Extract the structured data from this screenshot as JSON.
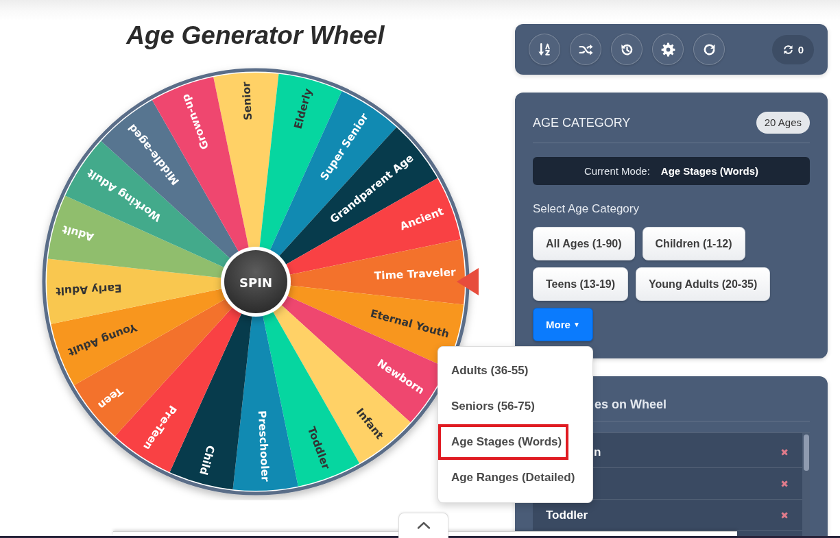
{
  "title": "Age Generator Wheel",
  "wheel": {
    "spin_label": "SPIN",
    "segments": [
      {
        "label": "Senior",
        "color": "#ffd166",
        "dark_label": true
      },
      {
        "label": "Elderly",
        "color": "#06d6a0",
        "dark_label": true
      },
      {
        "label": "Super Senior",
        "color": "#118ab2",
        "dark_label": false
      },
      {
        "label": "Grandparent Age",
        "color": "#073b4c",
        "dark_label": false
      },
      {
        "label": "Ancient",
        "color": "#f94144",
        "dark_label": false
      },
      {
        "label": "Time Traveler",
        "color": "#f3722c",
        "dark_label": false
      },
      {
        "label": "Eternal Youth",
        "color": "#f8961e",
        "dark_label": true
      },
      {
        "label": "Newborn",
        "color": "#ef476f",
        "dark_label": false
      },
      {
        "label": "Infant",
        "color": "#ffd166",
        "dark_label": true
      },
      {
        "label": "Toddler",
        "color": "#06d6a0",
        "dark_label": true
      },
      {
        "label": "Preschooler",
        "color": "#118ab2",
        "dark_label": false
      },
      {
        "label": "Child",
        "color": "#073b4c",
        "dark_label": false
      },
      {
        "label": "Pre-Teen",
        "color": "#f94144",
        "dark_label": false
      },
      {
        "label": "Teen",
        "color": "#f3722c",
        "dark_label": false
      },
      {
        "label": "Young Adult",
        "color": "#f8961e",
        "dark_label": true
      },
      {
        "label": "Early Adult",
        "color": "#f9c74f",
        "dark_label": true
      },
      {
        "label": "Adult",
        "color": "#90be6d",
        "dark_label": false
      },
      {
        "label": "Working Adult",
        "color": "#43aa8b",
        "dark_label": false
      },
      {
        "label": "Middle-aged",
        "color": "#577590",
        "dark_label": false
      },
      {
        "label": "Grown-up",
        "color": "#ef476f",
        "dark_label": false
      }
    ]
  },
  "toolbar": {
    "buttons": [
      {
        "kind": "sort"
      },
      {
        "kind": "shuffle"
      },
      {
        "kind": "history"
      },
      {
        "kind": "settings"
      },
      {
        "kind": "redo"
      }
    ],
    "spin_count": "0"
  },
  "category_panel": {
    "title": "AGE CATEGORY",
    "count_badge": "20 Ages",
    "mode_label": "Current Mode:",
    "mode_value": "Age Stages (Words)",
    "select_label": "Select Age Category",
    "options": [
      {
        "label": "All Ages (1-90)",
        "selected": false
      },
      {
        "label": "Children (1-12)",
        "selected": false
      },
      {
        "label": "Teens (13-19)",
        "selected": false
      },
      {
        "label": "Young Adults (20-35)",
        "selected": false
      }
    ],
    "more_button": {
      "label": "More",
      "caret": "▼",
      "expanded": true
    },
    "more_menu": [
      {
        "label": "Adults (36-55)",
        "highlighted": false
      },
      {
        "label": "Seniors (56-75)",
        "highlighted": false
      },
      {
        "label": "Age Stages (Words)",
        "highlighted": true
      },
      {
        "label": "Age Ranges (Detailed)",
        "highlighted": false
      }
    ]
  },
  "wheel_list": {
    "title": "es on Wheel",
    "title_covered": true,
    "items": [
      {
        "label": "n",
        "delete": "✖",
        "covered": true
      },
      {
        "delete": "✖"
      },
      {
        "label": "Toddler",
        "delete": "✖"
      }
    ]
  }
}
